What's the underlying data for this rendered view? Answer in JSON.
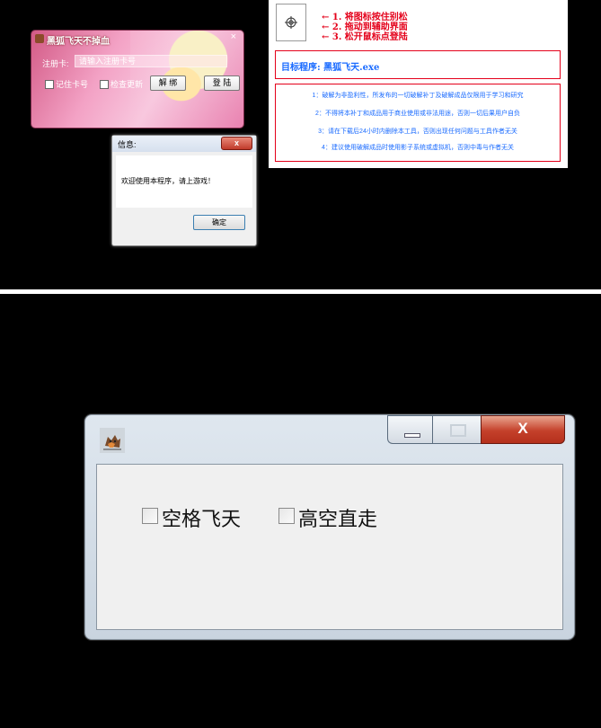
{
  "login_window": {
    "title": "黑狐飞天不掉血",
    "close_glyph": "×",
    "reg_label": "注册卡:",
    "reg_input_value": "请输入注册卡号",
    "remember_label": "记住卡号",
    "update_label": "检查更新",
    "unbind_label": "解 绑",
    "login_label": "登 陆"
  },
  "info_dialog": {
    "title": "信息:",
    "close_glyph": "x",
    "message": "欢迎使用本程序，请上游戏！",
    "ok_label": "确定"
  },
  "instructions": {
    "step1": "← 1. 将图标按住别松",
    "step2": "← 2. 拖动到辅助界面",
    "step3": "← 3. 松开鼠标点登陆",
    "target_program": "目标程序: 黑狐飞天.exe",
    "disclaimers": [
      "1：破解为非盈利性，所发布的一切破解补丁及破解成品仅限用于学习和研究",
      "2：不得将本补丁和成品用于商业使用或非法用途，否则一切后果用户自负",
      "3：请在下载后24小时内删除本工具，否则出现任何问题与工具作者无关",
      "4：建议使用破解成品时使用影子系统或虚拟机，否则中毒与作者无关"
    ]
  },
  "main_window": {
    "close_glyph": "X",
    "options": [
      {
        "label": "空格飞天",
        "checked": false
      },
      {
        "label": "高空直走",
        "checked": false
      }
    ]
  },
  "colors": {
    "instruction_red": "#e4001a",
    "instruction_blue": "#1a6bff",
    "close_red": "#c4402a"
  }
}
